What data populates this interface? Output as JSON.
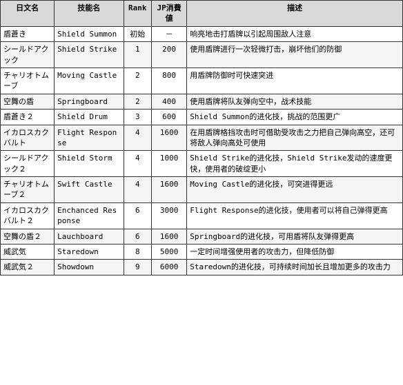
{
  "table": {
    "headers": {
      "jp_name": "日文名",
      "skill_name": "技能名",
      "rank": "Rank",
      "jp_cost": "JP消費値",
      "desc": "描述"
    },
    "rows": [
      {
        "jp_name": "盾蒼き",
        "skill_name": "Shield Summon",
        "rank": "初始",
        "jp_cost": "－",
        "desc": "响亮地击打盾牌以引起周围敌人注意"
      },
      {
        "jp_name": "シールドアクック",
        "skill_name": "Shield Strike",
        "rank": "1",
        "jp_cost": "200",
        "desc": "使用盾牌进行一次轻微打击，崩坏他们的防御"
      },
      {
        "jp_name": "チャリオトムーブ",
        "skill_name": "Moving Castle",
        "rank": "2",
        "jp_cost": "800",
        "desc": "用盾牌防御时可快速突进"
      },
      {
        "jp_name": "空舞の盾",
        "skill_name": "Springboard",
        "rank": "2",
        "jp_cost": "400",
        "desc": "使用盾牌将队友弹向空中，战术技能"
      },
      {
        "jp_name": "盾蒼き２",
        "skill_name": "Shield Drum",
        "rank": "3",
        "jp_cost": "600",
        "desc": "Shield Summon的进化技，挑战的范围更广"
      },
      {
        "jp_name": "イカロスカクバルト",
        "skill_name": "Flight Response",
        "rank": "4",
        "jp_cost": "1600",
        "desc": "在用盾牌格挡攻击时可借助受攻击之力把自己弹向高空，还可将敌人弹向高处可使用"
      },
      {
        "jp_name": "シールドアクック２",
        "skill_name": "Shield Storm",
        "rank": "4",
        "jp_cost": "1000",
        "desc": "Shield Strike的进化技，Shield Strike发动的速度更快，使用者的破绽更小"
      },
      {
        "jp_name": "チャリオトムーブ２",
        "skill_name": "Swift Castle",
        "rank": "4",
        "jp_cost": "1600",
        "desc": "Moving Castle的进化技，可突进得更远"
      },
      {
        "jp_name": "イカロスカクバルト２",
        "skill_name": "Enchanced Response",
        "rank": "6",
        "jp_cost": "3000",
        "desc": "Flight Response的进化技，使用者可以将自己弹得更高"
      },
      {
        "jp_name": "空舞の盾２",
        "skill_name": "Lauchboard",
        "rank": "6",
        "jp_cost": "1600",
        "desc": "Springboard的进化技，可用盾将队友弹得更高"
      },
      {
        "jp_name": "威武気",
        "skill_name": "Staredown",
        "rank": "8",
        "jp_cost": "5000",
        "desc": "一定时间增强使用者的攻击力，但降低防御"
      },
      {
        "jp_name": "威武気２",
        "skill_name": "Showdown",
        "rank": "9",
        "jp_cost": "6000",
        "desc": "Staredown的进化技，可持续时间加长且增加更多的攻击力"
      }
    ]
  }
}
